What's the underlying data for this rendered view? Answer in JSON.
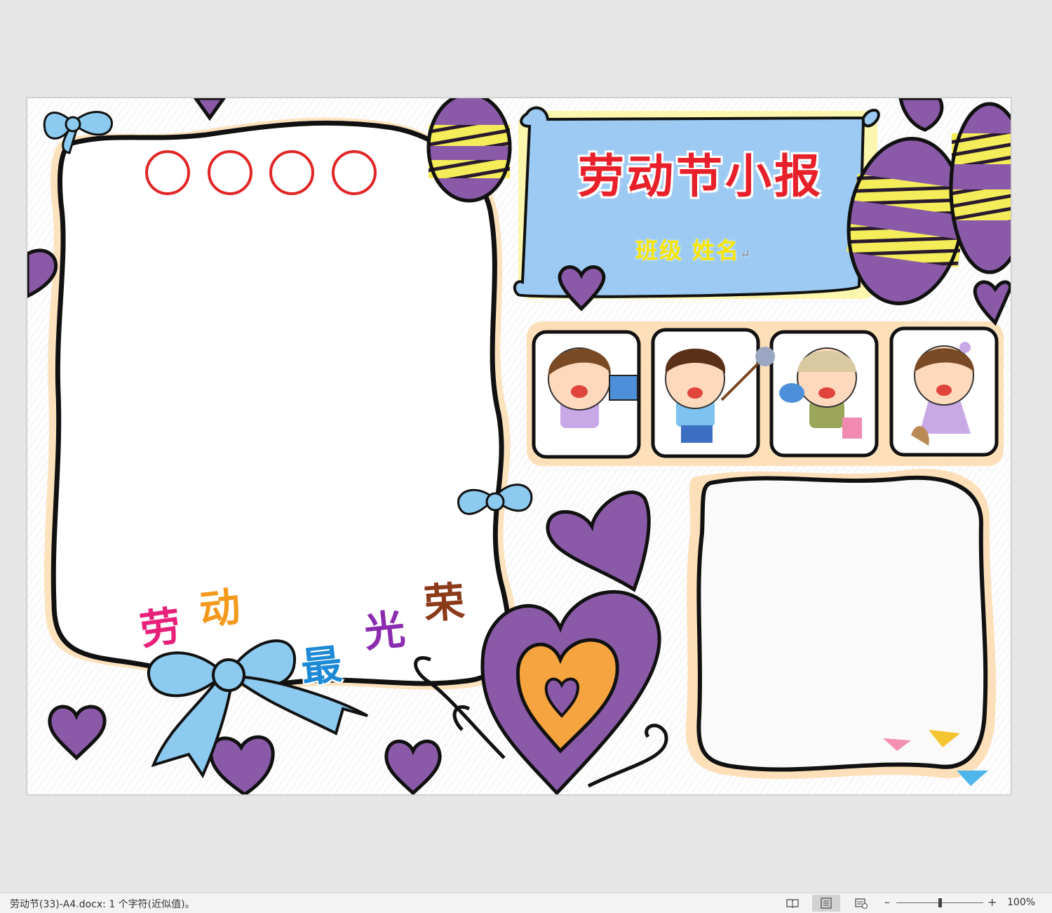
{
  "document": {
    "title": "劳动节小报",
    "subtitle": "班级  姓名",
    "paragraph_mark": "↵",
    "slogan": [
      "劳",
      "动",
      "最",
      "光",
      "荣"
    ],
    "slogan_colors": [
      "#e8207a",
      "#f39a1c",
      "#1c8ad6",
      "#8a2bb0",
      "#8b3a1a"
    ],
    "title_color": "#e8202a",
    "subtitle_color": "#f4e400",
    "accent_purple": "#8a5aa8",
    "accent_yellow": "#f5ec5a",
    "banner_blue": "#9ccaf2"
  },
  "statusbar": {
    "doc_info": "劳动节(33)-A4.docx: 1 个字符(近似值)。",
    "views": [
      "read-mode-icon",
      "print-layout-icon",
      "web-layout-icon"
    ],
    "zoom_minus": "–",
    "zoom_plus": "+",
    "zoom_level": "100%"
  }
}
